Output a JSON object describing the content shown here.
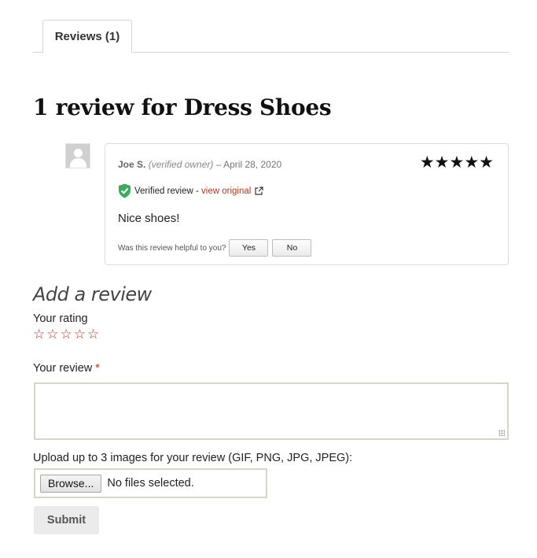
{
  "tabs": [
    {
      "label": "Reviews (1)"
    }
  ],
  "reviews_heading": "1 review for Dress Shoes",
  "review": {
    "author": "Joe S.",
    "owner_label": "(verified owner)",
    "separator": "–",
    "date": "April 28, 2020",
    "stars": "★★★★★",
    "rating": 5,
    "verified_text": "Verified review -",
    "view_original": "view original",
    "text": "Nice shoes!",
    "helpful_question": "Was this review helpful to you?",
    "yes_label": "Yes",
    "no_label": "No"
  },
  "add_review": {
    "title": "Add a review",
    "rating_label": "Your rating",
    "rating_stars": [
      "☆",
      "☆",
      "☆",
      "☆",
      "☆"
    ],
    "review_label": "Your review",
    "required_mark": "*",
    "upload_label": "Upload up to 3 images for your review (GIF, PNG, JPG, JPEG):",
    "browse_label": "Browse...",
    "no_files": "No files selected.",
    "submit_label": "Submit"
  },
  "icons": {
    "avatar": "user-avatar-icon",
    "verified": "shield-check-icon",
    "external": "external-link-icon",
    "star_filled": "star-filled-icon",
    "star_empty": "star-outline-icon"
  },
  "colors": {
    "accent": "#b5381c",
    "verified_green": "#3daa5c",
    "field_border": "#d7d7c7"
  }
}
